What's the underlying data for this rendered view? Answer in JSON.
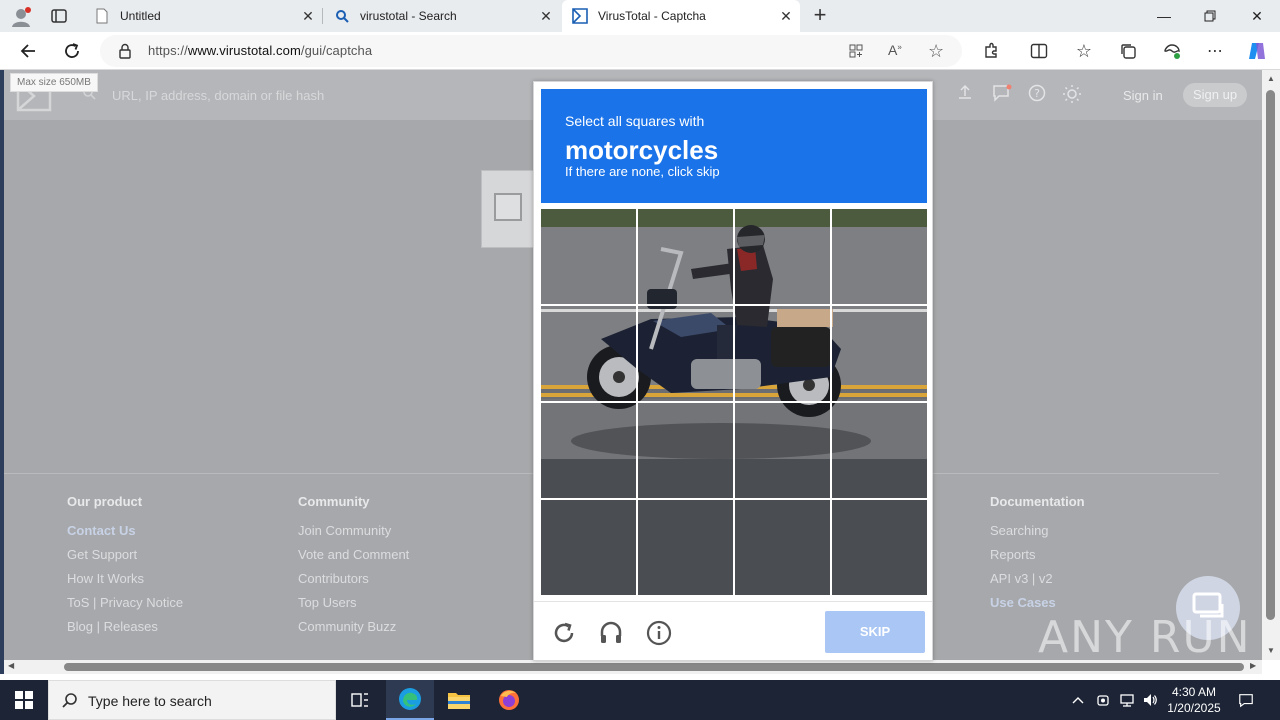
{
  "browser": {
    "tabs": [
      {
        "title": "Untitled",
        "icon": "page-icon"
      },
      {
        "title": "virustotal - Search",
        "icon": "search-icon"
      },
      {
        "title": "VirusTotal - Captcha",
        "icon": "virustotal-icon",
        "active": true
      }
    ],
    "url_prefix": "https://",
    "url_domain": "www.virustotal.com",
    "url_path": "/gui/captcha"
  },
  "page": {
    "max_size": "Max size 650MB",
    "search_placeholder": "URL, IP address, domain or file hash",
    "sign_in": "Sign in",
    "sign_up": "Sign up",
    "footer": [
      {
        "heading": "Our product",
        "links": [
          "Contact Us",
          "Get Support",
          "How It Works",
          "ToS | Privacy Notice",
          "Blog | Releases"
        ]
      },
      {
        "heading": "Community",
        "links": [
          "Join Community",
          "Vote and Comment",
          "Contributors",
          "Top Users",
          "Community Buzz"
        ]
      },
      {
        "heading": "Documentation",
        "links": [
          "Searching",
          "Reports",
          "API v3 | v2",
          "Use Cases"
        ]
      }
    ]
  },
  "captcha": {
    "line1": "Select all squares with",
    "target": "motorcycles",
    "line3": "If there are none, click skip",
    "skip_label": "SKIP",
    "header_color": "#1a73e8"
  },
  "watermark": "ANY RUN",
  "taskbar": {
    "search_placeholder": "Type here to search",
    "time": "4:30 AM",
    "date": "1/20/2025"
  }
}
